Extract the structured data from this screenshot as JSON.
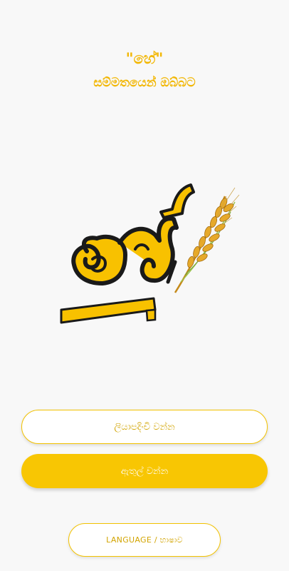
{
  "header": {
    "title": "\"හේ\"",
    "subtitle": "සම්මතයෙන් ඔබ්බට"
  },
  "logo": {
    "icon": "he-wheat-logo-icon",
    "text": "හේ"
  },
  "buttons": {
    "register_label": "ලියාපදිංචි වන්න",
    "login_label": "ඇතුල් වන්න",
    "language_label": "LANGUAGE / භාෂාව"
  },
  "colors": {
    "accent": "#f8c603",
    "accent_text": "#f2b705",
    "background": "#f8f8f8"
  }
}
